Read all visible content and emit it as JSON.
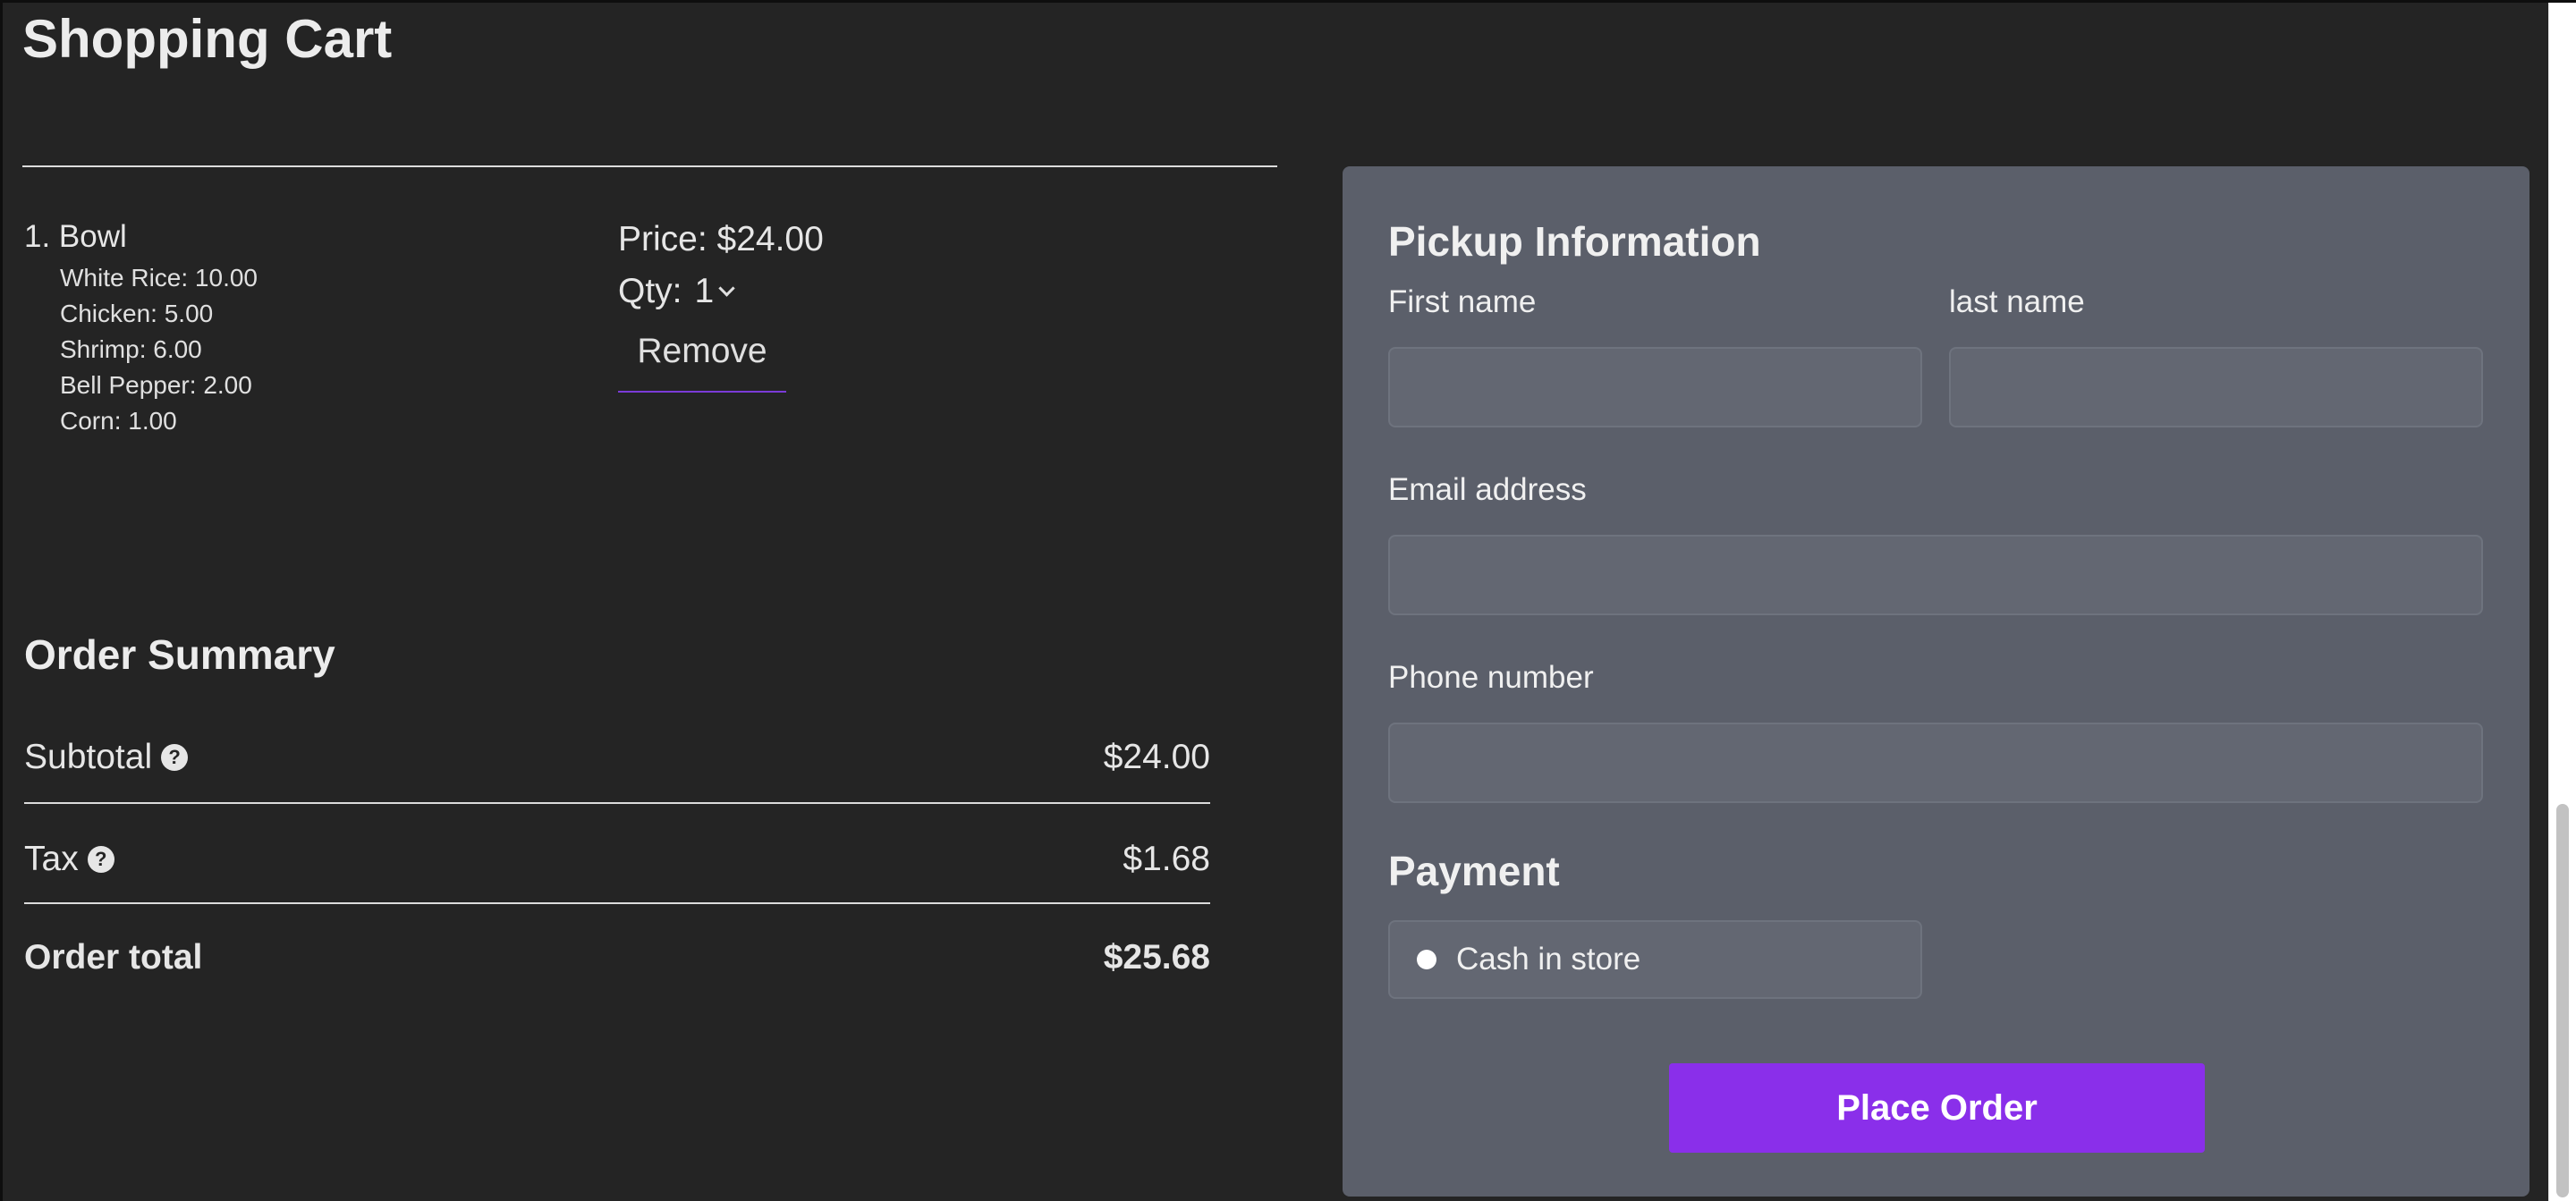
{
  "page": {
    "title": "Shopping Cart"
  },
  "cart": {
    "items": [
      {
        "name": "1. Bowl",
        "ingredients": [
          "White Rice: 10.00",
          "Chicken: 5.00",
          "Shrimp: 6.00",
          "Bell Pepper: 2.00",
          "Corn: 1.00"
        ],
        "price_text": "Price: $24.00",
        "qty_label": "Qty:",
        "qty_value": "1",
        "remove_label": "Remove"
      }
    ]
  },
  "summary": {
    "title": "Order Summary",
    "subtotal_label": "Subtotal",
    "subtotal_value": "$24.00",
    "tax_label": "Tax",
    "tax_value": "$1.68",
    "total_label": "Order total",
    "total_value": "$25.68",
    "help_glyph": "?"
  },
  "pickup": {
    "title": "Pickup Information",
    "first_name_label": "First name",
    "first_name_value": "",
    "last_name_label": "last name",
    "last_name_value": "",
    "email_label": "Email address",
    "email_value": "",
    "phone_label": "Phone number",
    "phone_value": ""
  },
  "payment": {
    "title": "Payment",
    "options": [
      {
        "label": "Cash in store",
        "selected": false
      }
    ]
  },
  "actions": {
    "place_order_label": "Place Order"
  },
  "colors": {
    "background": "#242424",
    "panel": "#5b5f6a",
    "accent": "#8a2fea",
    "remove_underline": "#7b3bd8"
  },
  "icons": {
    "help": "question-circle-icon",
    "qty_dropdown": "chevron-down-icon",
    "radio": "radio-icon"
  }
}
